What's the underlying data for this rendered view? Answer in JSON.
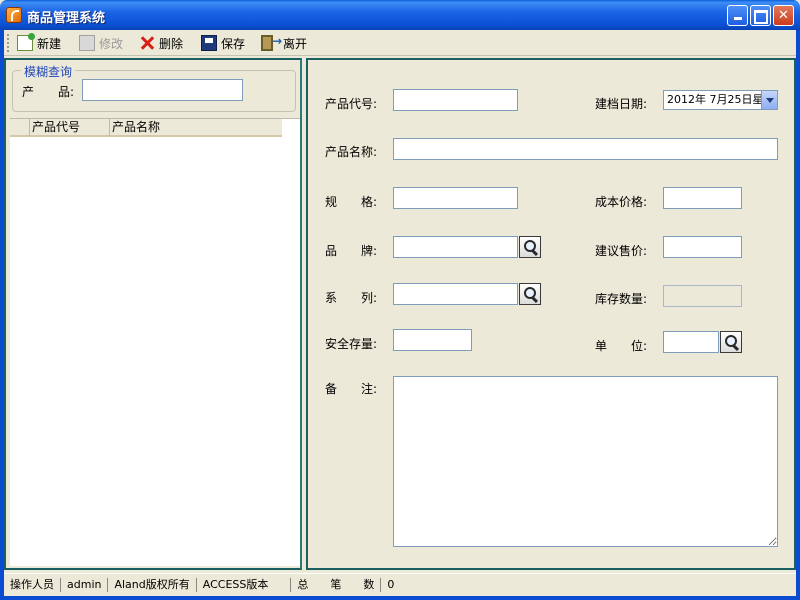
{
  "window": {
    "title": "商品管理系统"
  },
  "toolbar": {
    "new_label": "新建",
    "edit_label": "修改",
    "delete_label": "删除",
    "save_label": "保存",
    "exit_label": "离开"
  },
  "search": {
    "group_title": "模糊查询",
    "product_label": "产　　品:",
    "product_value": ""
  },
  "grid": {
    "columns": [
      "产品代号",
      "产品名称"
    ]
  },
  "form": {
    "code_label": "产品代号:",
    "date_label": "建档日期:",
    "date_value": "2012年 7月25日星",
    "name_label": "产品名称:",
    "spec_label": "规　　格:",
    "cost_label": "成本价格:",
    "brand_label": "品　　牌:",
    "suggest_price_label": "建议售价:",
    "series_label": "系　　列:",
    "stock_label": "库存数量:",
    "safe_stock_label": "安全存量:",
    "unit_label": "单　　位:",
    "remark_label": "备　　注:"
  },
  "status": {
    "operator_label": "操作人员",
    "operator_value": "admin",
    "copyright": "Aland版权所有",
    "version": "ACCESS版本",
    "total_label": "总　　笔　　数",
    "total_value": "0"
  }
}
